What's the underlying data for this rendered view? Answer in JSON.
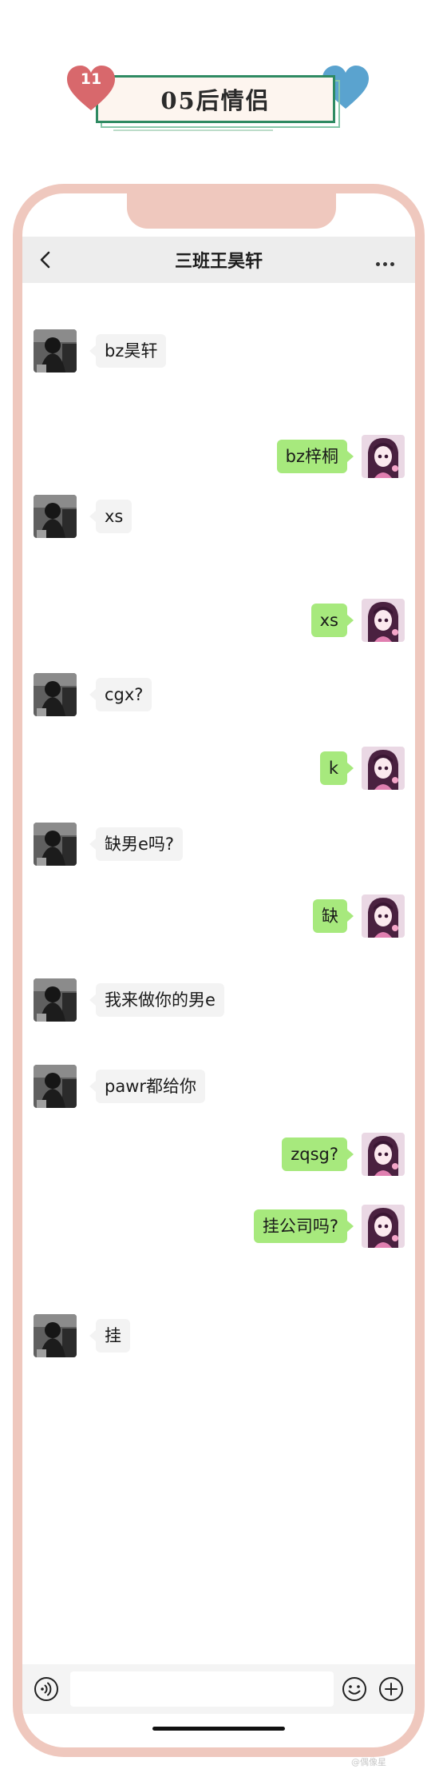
{
  "badge": {
    "title": "05后情侣",
    "number": "11"
  },
  "chat": {
    "title": "三班王昊轩",
    "input_placeholder": ""
  },
  "messages": [
    {
      "side": "left",
      "text": "bz昊轩"
    },
    {
      "side": "right",
      "text": "bz梓桐"
    },
    {
      "side": "left",
      "text": "xs"
    },
    {
      "side": "right",
      "text": "xs"
    },
    {
      "side": "left",
      "text": "cgx?"
    },
    {
      "side": "right",
      "text": "k"
    },
    {
      "side": "left",
      "text": "缺男e吗?"
    },
    {
      "side": "right",
      "text": "缺"
    },
    {
      "side": "left",
      "text": "我来做你的男e"
    },
    {
      "side": "left",
      "text": "pawr都给你"
    },
    {
      "side": "right",
      "text": "zqsg?"
    },
    {
      "side": "right",
      "text": "挂公司吗?"
    },
    {
      "side": "left",
      "text": "挂"
    }
  ],
  "watermark": "@偶像星",
  "colors": {
    "frame": "#efc8be",
    "bubble_sent": "#a7e97d",
    "bubble_received": "#f3f3f3",
    "badge_border": "#2e8a62",
    "heart_pink": "#d8686c",
    "heart_blue": "#5aa3cf"
  },
  "icons": {
    "back": "chevron-left-icon",
    "more": "more-dots-icon",
    "voice": "voice-icon",
    "emoji": "emoji-icon",
    "plus": "plus-icon"
  }
}
